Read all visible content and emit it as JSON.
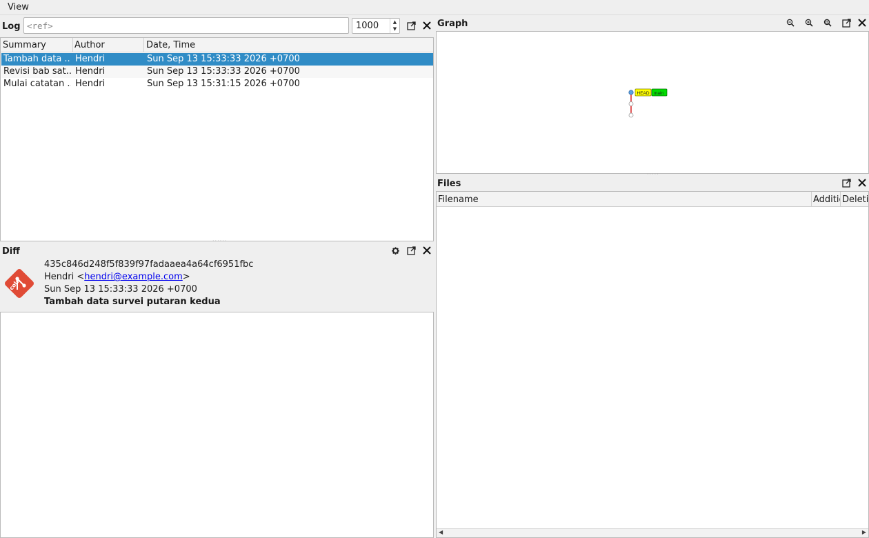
{
  "menu": {
    "view": "View"
  },
  "log": {
    "title": "Log",
    "ref_placeholder": "<ref>",
    "limit": "1000",
    "columns": [
      "Summary",
      "Author",
      "Date, Time"
    ],
    "rows": [
      {
        "summary": "Tambah data ...",
        "author": "Hendri",
        "date": "Sun Sep 13 15:33:33 2026 +0700"
      },
      {
        "summary": "Revisi bab sat...",
        "author": "Hendri",
        "date": "Sun Sep 13 15:33:33 2026 +0700"
      },
      {
        "summary": "Mulai catatan ...",
        "author": "Hendri",
        "date": "Sun Sep 13 15:31:15 2026 +0700"
      }
    ]
  },
  "diff": {
    "title": "Diff",
    "sha": "435c846d248f5f839f97fadaaea4a64cf6951fbc",
    "author_name": "Hendri <",
    "author_email": "hendri@example.com",
    "author_close": ">",
    "date": "Sun Sep 13 15:33:33 2026 +0700",
    "subject": "Tambah data survei putaran kedua",
    "logo_text": "cola"
  },
  "graph": {
    "title": "Graph",
    "labels": {
      "head": "HEAD",
      "branch": "main"
    },
    "colors": {
      "head": "#ffff00",
      "branch": "#00dd00",
      "edge": "#d62020",
      "node_top": "#5aa0e0"
    }
  },
  "files": {
    "title": "Files",
    "columns": [
      "Filename",
      "Additio",
      "Deletio"
    ]
  }
}
